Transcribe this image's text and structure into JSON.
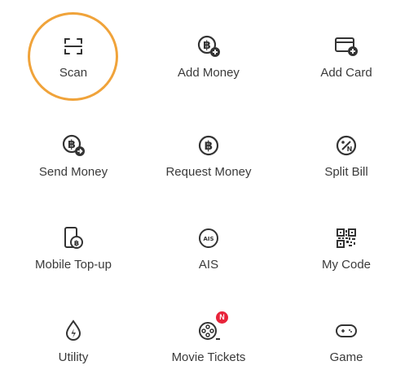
{
  "colors": {
    "icon": "#333333",
    "label": "#3a3a3a",
    "highlight": "#f0a33a",
    "badge": "#e8233a"
  },
  "menu": {
    "items": [
      {
        "label": "Scan",
        "icon": "scan-icon"
      },
      {
        "label": "Add Money",
        "icon": "add-money-icon"
      },
      {
        "label": "Add Card",
        "icon": "add-card-icon"
      },
      {
        "label": "Send Money",
        "icon": "send-money-icon"
      },
      {
        "label": "Request Money",
        "icon": "request-money-icon"
      },
      {
        "label": "Split Bill",
        "icon": "split-bill-icon"
      },
      {
        "label": "Mobile Top-up",
        "icon": "mobile-topup-icon"
      },
      {
        "label": "AIS",
        "icon": "ais-icon",
        "icon_text": "AIS"
      },
      {
        "label": "My Code",
        "icon": "qr-code-icon"
      },
      {
        "label": "Utility",
        "icon": "utility-icon"
      },
      {
        "label": "Movie Tickets",
        "icon": "movie-tickets-icon",
        "badge": "N"
      },
      {
        "label": "Game",
        "icon": "game-icon"
      }
    ]
  }
}
